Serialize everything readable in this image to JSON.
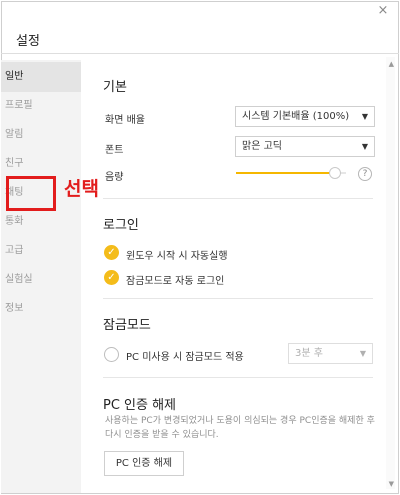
{
  "window": {
    "close_symbol": "×",
    "title": "설정"
  },
  "sidebar": {
    "items": [
      {
        "label": "일반",
        "active": true
      },
      {
        "label": "프로필",
        "active": false
      },
      {
        "label": "알림",
        "active": false
      },
      {
        "label": "친구",
        "active": false
      },
      {
        "label": "채팅",
        "active": false
      },
      {
        "label": "통화",
        "active": false
      },
      {
        "label": "고급",
        "active": false
      },
      {
        "label": "실험실",
        "active": false
      },
      {
        "label": "정보",
        "active": false
      }
    ]
  },
  "annotation": {
    "label": "선택",
    "color": "#e21c1c"
  },
  "scrollbar": {
    "up_symbol": "▲",
    "down_symbol": "▼"
  },
  "sections": {
    "basic": {
      "title": "기본",
      "screen_scale": {
        "label": "화면 배율",
        "value": "시스템 기본배율 (100%)",
        "arrow": "▼"
      },
      "font": {
        "label": "폰트",
        "value": "맑은 고딕",
        "arrow": "▼"
      },
      "volume": {
        "label": "음량",
        "level_percent": 90,
        "help_symbol": "?"
      }
    },
    "login": {
      "title": "로그인",
      "options": [
        {
          "label": "윈도우 시작 시 자동실행",
          "checked": true
        },
        {
          "label": "잠금모드로 자동 로그인",
          "checked": true
        }
      ],
      "check_symbol": "✓"
    },
    "lock": {
      "title": "잠금모드",
      "option_label": "PC 미사용 시 잠금모드 적용",
      "select_value": "3분 후",
      "arrow": "▼"
    },
    "pc_auth": {
      "title": "PC 인증 해제",
      "description": "사용하는 PC가 변경되었거나 도용이 의심되는 경우 PC인증을 해제한 후 다시 인증을 받을 수 있습니다.",
      "button_label": "PC 인증 해제"
    }
  },
  "colors": {
    "accent": "#f4bc1a",
    "highlight": "#e21c1c"
  }
}
